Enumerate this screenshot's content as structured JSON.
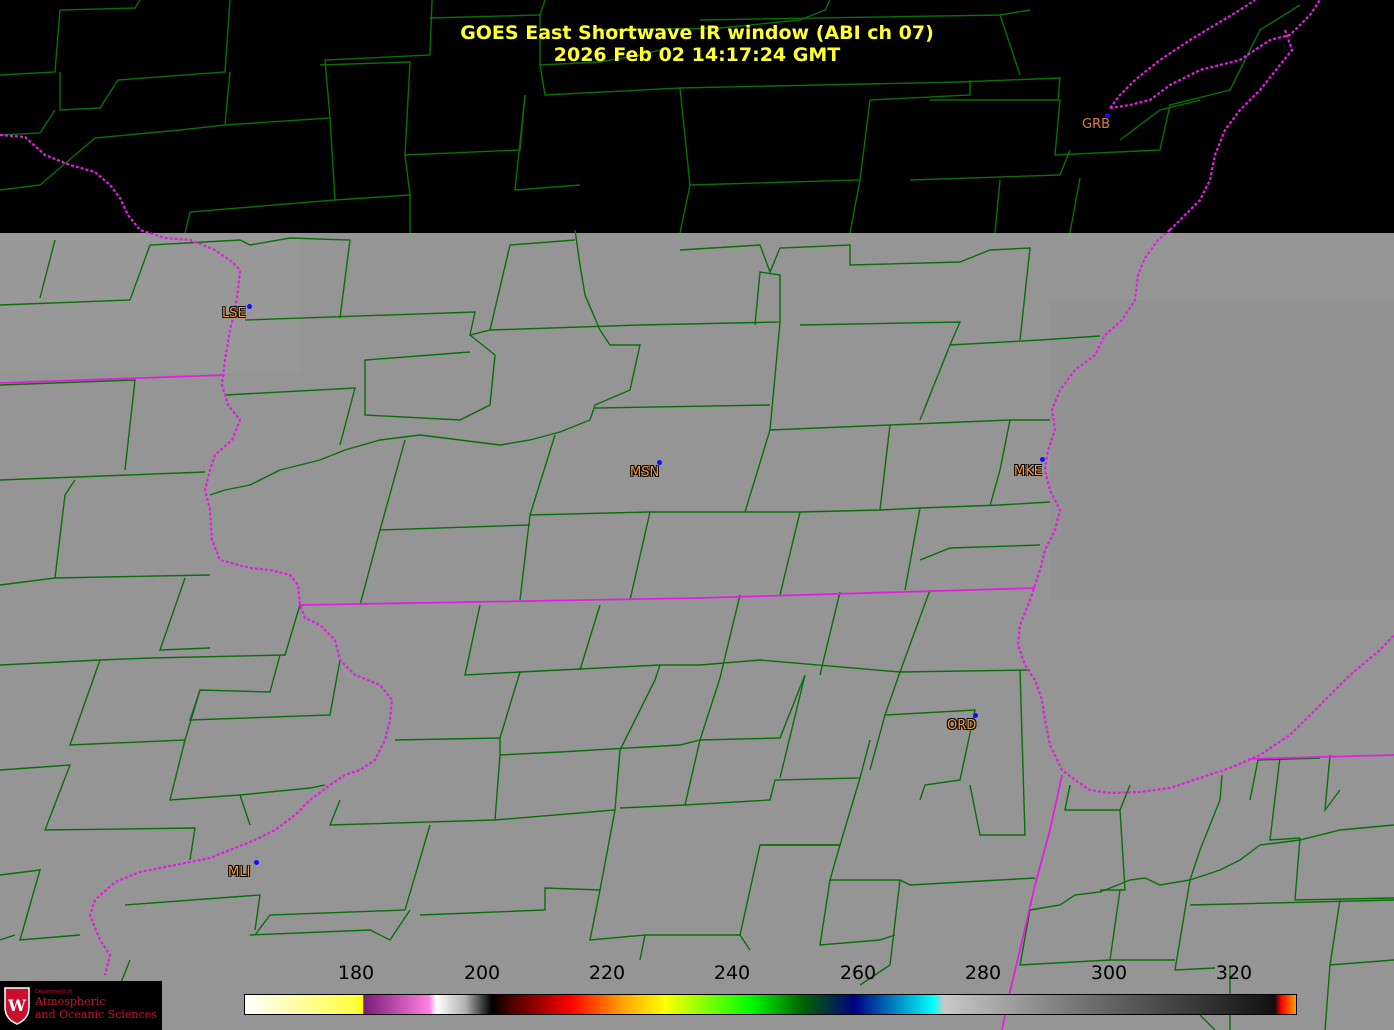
{
  "title": {
    "line1": "GOES East Shortwave IR window (ABI ch 07)",
    "line2": "2026 Feb 02  14:17:24 GMT"
  },
  "stations": [
    {
      "id": "GRB",
      "label": "GRB"
    },
    {
      "id": "LSE",
      "label": "LSE"
    },
    {
      "id": "MSN",
      "label": "MSN"
    },
    {
      "id": "MKE",
      "label": "MKE"
    },
    {
      "id": "ORD",
      "label": "ORD"
    },
    {
      "id": "MLI",
      "label": "MLI"
    }
  ],
  "colorbar": {
    "unit_range": [
      160,
      330
    ],
    "ticks": [
      "180",
      "200",
      "220",
      "240",
      "260",
      "280",
      "300",
      "320"
    ]
  },
  "logo": {
    "small_text": "Department of",
    "line1": "Atmospheric",
    "line2": "and Oceanic Sciences",
    "seal_letter": "W"
  },
  "colors": {
    "county_lines": "#0a6e0a",
    "state_borders": "#e020e0",
    "title": "#ffff33",
    "station_label": "#ff9933",
    "station_dot": "#1010ff",
    "cloud_gray": "#959595",
    "no_data": "#000000"
  }
}
